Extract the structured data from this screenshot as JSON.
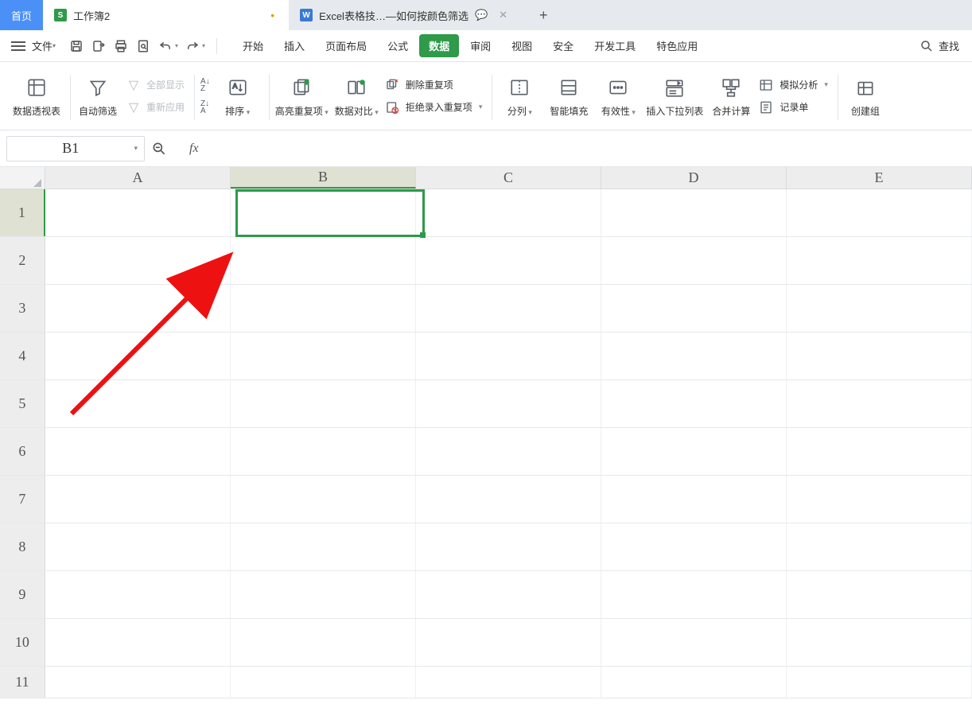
{
  "tabs": {
    "home": "首页",
    "doc1": {
      "label": "工作簿2",
      "modified": "•"
    },
    "doc2": {
      "label": "Excel表格技…—如何按颜色筛选"
    },
    "add": "+"
  },
  "menu": {
    "file": "文件",
    "ribbon_tabs": [
      "开始",
      "插入",
      "页面布局",
      "公式",
      "数据",
      "审阅",
      "视图",
      "安全",
      "开发工具",
      "特色应用"
    ],
    "active_ribbon": "数据",
    "search": "查找"
  },
  "ribbon": {
    "pivot": "数据透视表",
    "filter": "自动筛选",
    "showAll": "全部显示",
    "reapply": "重新应用",
    "sort": "排序",
    "highlightDup": "高亮重复项",
    "dataCompare": "数据对比",
    "removeDup": "删除重复项",
    "denyDup": "拒绝录入重复项",
    "splitCol": "分列",
    "smartFill": "智能填充",
    "validity": "有效性",
    "insertDropdown": "插入下拉列表",
    "consolidate": "合并计算",
    "whatif": "模拟分析",
    "recordForm": "记录单",
    "createGroup": "创建组"
  },
  "namebox": "B1",
  "fx": "fx",
  "columns": [
    "A",
    "B",
    "C",
    "D",
    "E"
  ],
  "rows": [
    "1",
    "2",
    "3",
    "4",
    "5",
    "6",
    "7",
    "8",
    "9",
    "10",
    "11"
  ],
  "activeColIndex": 1,
  "activeRowIndex": 0
}
